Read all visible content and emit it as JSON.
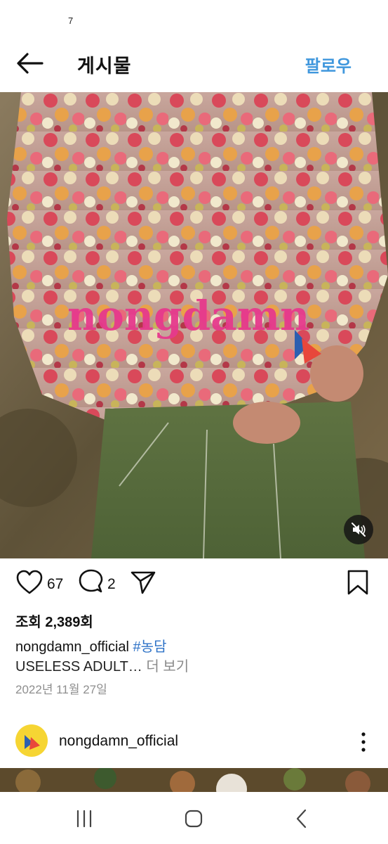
{
  "status_bar": {
    "text": "7"
  },
  "header": {
    "title": "게시물",
    "follow_label": "팔로우"
  },
  "post": {
    "watermark": "nongdamn",
    "likes": "67",
    "comments": "2",
    "views": "조회 2,389회",
    "username": "nongdamn_official",
    "hashtag": "#농담",
    "caption": "USELESS ADULT…",
    "more": "더 보기",
    "date": "2022년 11월 27일"
  },
  "next_post": {
    "username": "nongdamn_official"
  },
  "colors": {
    "accent": "#3f97dd",
    "hashtag": "#2f73c7",
    "muted": "#8e8e8e"
  }
}
